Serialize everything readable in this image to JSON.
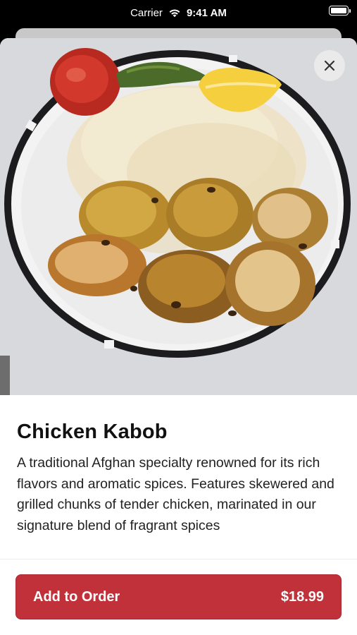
{
  "status_bar": {
    "carrier": "Carrier",
    "time": "9:41 AM",
    "wifi_icon": "wifi-icon",
    "battery_icon": "battery-icon"
  },
  "item": {
    "name": "Chicken Kabob",
    "description": "A traditional Afghan specialty renowned for its rich flavors and aromatic spices. Features skewered and grilled chunks of tender chicken, marinated in our signature blend of fragrant spices",
    "image_icon": "food-photo"
  },
  "close_icon": "close-icon",
  "order_button": {
    "label": "Add to Order",
    "price": "$18.99"
  },
  "colors": {
    "accent": "#c0313a",
    "background": "#ffffff",
    "text": "#111111"
  }
}
